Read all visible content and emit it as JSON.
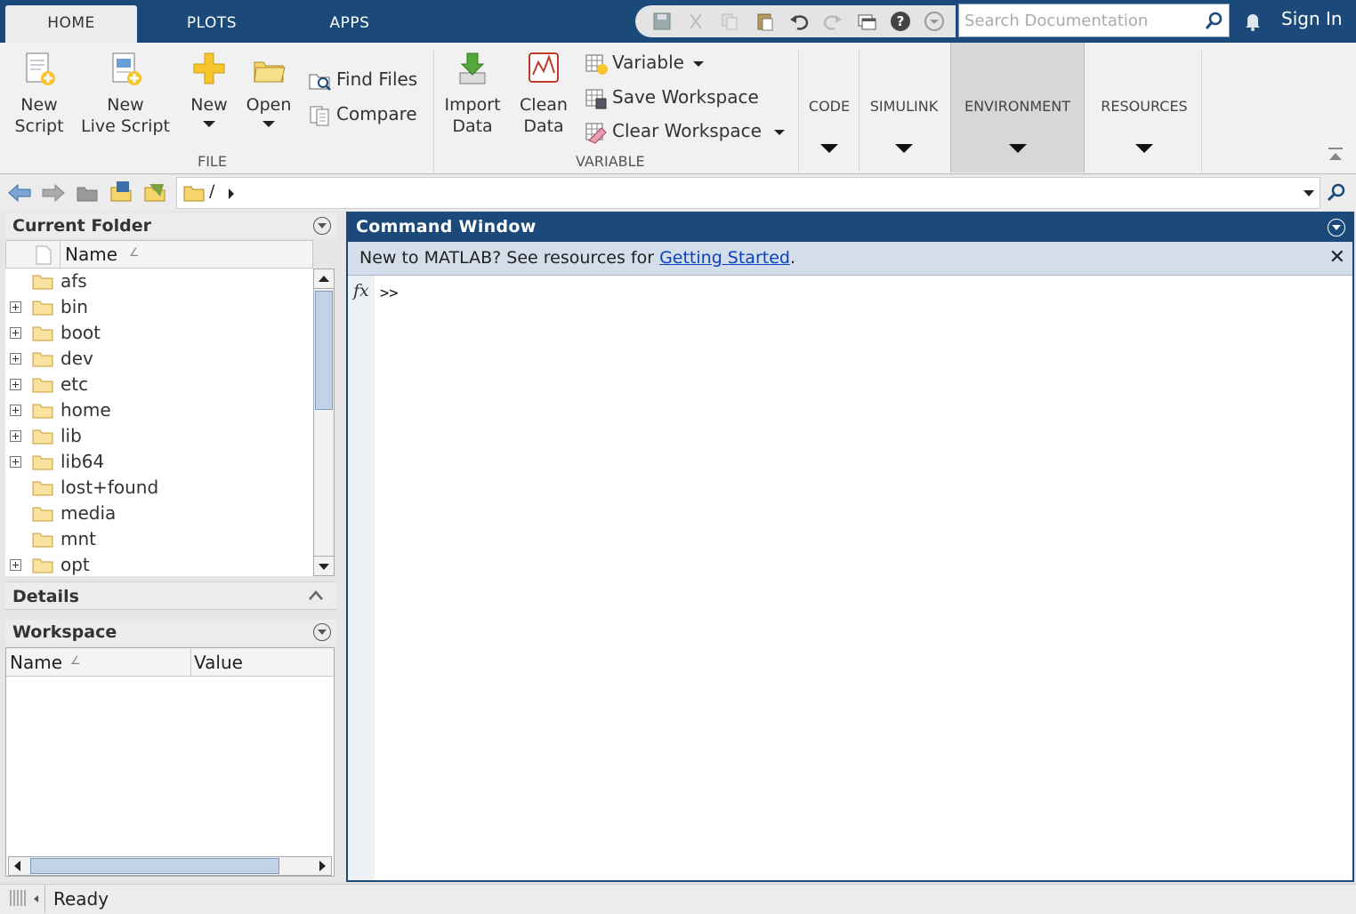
{
  "tabs": [
    {
      "label": "HOME",
      "active": true
    },
    {
      "label": "PLOTS",
      "active": false
    },
    {
      "label": "APPS",
      "active": false
    }
  ],
  "search": {
    "placeholder": "Search Documentation"
  },
  "sign_in": "Sign In",
  "ribbon": {
    "file": {
      "new_script": [
        "New",
        "Script"
      ],
      "new_live_script": [
        "New",
        "Live Script"
      ],
      "new": "New",
      "open": "Open",
      "find_files": "Find Files",
      "compare": "Compare",
      "group_label": "FILE"
    },
    "variable": {
      "import_data": [
        "Import",
        "Data"
      ],
      "clean_data": [
        "Clean",
        "Data"
      ],
      "variable": "Variable",
      "save_workspace": "Save Workspace",
      "clear_workspace": "Clear Workspace",
      "group_label": "VARIABLE"
    },
    "collapsed": [
      "CODE",
      "SIMULINK",
      "ENVIRONMENT",
      "RESOURCES"
    ]
  },
  "address": {
    "path": "/"
  },
  "current_folder": {
    "title": "Current Folder",
    "column": "Name",
    "items": [
      {
        "name": "afs",
        "expandable": false
      },
      {
        "name": "bin",
        "expandable": true
      },
      {
        "name": "boot",
        "expandable": true
      },
      {
        "name": "dev",
        "expandable": true
      },
      {
        "name": "etc",
        "expandable": true
      },
      {
        "name": "home",
        "expandable": true
      },
      {
        "name": "lib",
        "expandable": true
      },
      {
        "name": "lib64",
        "expandable": true
      },
      {
        "name": "lost+found",
        "expandable": false
      },
      {
        "name": "media",
        "expandable": false
      },
      {
        "name": "mnt",
        "expandable": false
      },
      {
        "name": "opt",
        "expandable": true
      }
    ]
  },
  "details": {
    "title": "Details"
  },
  "workspace": {
    "title": "Workspace",
    "col_name": "Name",
    "col_value": "Value"
  },
  "command_window": {
    "title": "Command Window",
    "banner_text": "New to MATLAB? See resources for ",
    "banner_link": "Getting Started",
    "banner_end": ".",
    "prompt": ">>",
    "fx": "fx"
  },
  "status": {
    "text": "Ready"
  },
  "colors": {
    "brand_blue": "#1b4a7a",
    "banner": "#d3deea",
    "link": "#0b3fc0"
  }
}
